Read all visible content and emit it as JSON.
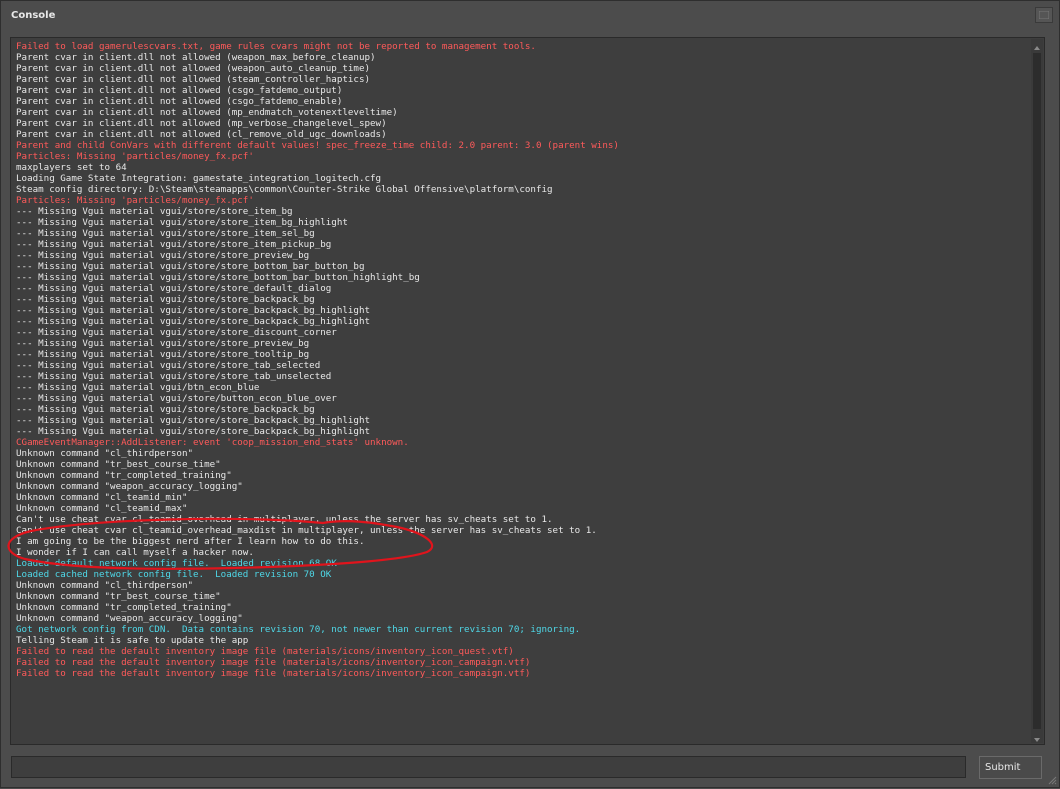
{
  "window": {
    "title": "Console"
  },
  "log": [
    {
      "text": "Failed to load gamerulescvars.txt, game rules cvars might not be reported to management tools.",
      "level": "error"
    },
    {
      "text": "Parent cvar in client.dll not allowed (weapon_max_before_cleanup)",
      "level": "normal"
    },
    {
      "text": "Parent cvar in client.dll not allowed (weapon_auto_cleanup_time)",
      "level": "normal"
    },
    {
      "text": "Parent cvar in client.dll not allowed (steam_controller_haptics)",
      "level": "normal"
    },
    {
      "text": "Parent cvar in client.dll not allowed (csgo_fatdemo_output)",
      "level": "normal"
    },
    {
      "text": "Parent cvar in client.dll not allowed (csgo_fatdemo_enable)",
      "level": "normal"
    },
    {
      "text": "Parent cvar in client.dll not allowed (mp_endmatch_votenextleveltime)",
      "level": "normal"
    },
    {
      "text": "Parent cvar in client.dll not allowed (mp_verbose_changelevel_spew)",
      "level": "normal"
    },
    {
      "text": "Parent cvar in client.dll not allowed (cl_remove_old_ugc_downloads)",
      "level": "normal"
    },
    {
      "text": "Parent and child ConVars with different default values! spec_freeze_time child: 2.0 parent: 3.0 (parent wins)",
      "level": "error"
    },
    {
      "text": "Particles: Missing 'particles/money_fx.pcf'",
      "level": "error"
    },
    {
      "text": "maxplayers set to 64",
      "level": "normal"
    },
    {
      "text": "Loading Game State Integration: gamestate_integration_logitech.cfg",
      "level": "normal"
    },
    {
      "text": "Steam config directory: D:\\Steam\\steamapps\\common\\Counter-Strike Global Offensive\\platform\\config",
      "level": "normal"
    },
    {
      "text": "Particles: Missing 'particles/money_fx.pcf'",
      "level": "error"
    },
    {
      "text": "--- Missing Vgui material vgui/store/store_item_bg",
      "level": "normal"
    },
    {
      "text": "--- Missing Vgui material vgui/store/store_item_bg_highlight",
      "level": "normal"
    },
    {
      "text": "--- Missing Vgui material vgui/store/store_item_sel_bg",
      "level": "normal"
    },
    {
      "text": "--- Missing Vgui material vgui/store/store_item_pickup_bg",
      "level": "normal"
    },
    {
      "text": "--- Missing Vgui material vgui/store/store_preview_bg",
      "level": "normal"
    },
    {
      "text": "--- Missing Vgui material vgui/store/store_bottom_bar_button_bg",
      "level": "normal"
    },
    {
      "text": "--- Missing Vgui material vgui/store/store_bottom_bar_button_highlight_bg",
      "level": "normal"
    },
    {
      "text": "--- Missing Vgui material vgui/store/store_default_dialog",
      "level": "normal"
    },
    {
      "text": "--- Missing Vgui material vgui/store/store_backpack_bg",
      "level": "normal"
    },
    {
      "text": "--- Missing Vgui material vgui/store/store_backpack_bg_highlight",
      "level": "normal"
    },
    {
      "text": "--- Missing Vgui material vgui/store/store_backpack_bg_highlight",
      "level": "normal"
    },
    {
      "text": "--- Missing Vgui material vgui/store/store_discount_corner",
      "level": "normal"
    },
    {
      "text": "--- Missing Vgui material vgui/store/store_preview_bg",
      "level": "normal"
    },
    {
      "text": "--- Missing Vgui material vgui/store/store_tooltip_bg",
      "level": "normal"
    },
    {
      "text": "--- Missing Vgui material vgui/store/store_tab_selected",
      "level": "normal"
    },
    {
      "text": "--- Missing Vgui material vgui/store/store_tab_unselected",
      "level": "normal"
    },
    {
      "text": "--- Missing Vgui material vgui/btn_econ_blue",
      "level": "normal"
    },
    {
      "text": "--- Missing Vgui material vgui/store/button_econ_blue_over",
      "level": "normal"
    },
    {
      "text": "--- Missing Vgui material vgui/store/store_backpack_bg",
      "level": "normal"
    },
    {
      "text": "--- Missing Vgui material vgui/store/store_backpack_bg_highlight",
      "level": "normal"
    },
    {
      "text": "--- Missing Vgui material vgui/store/store_backpack_bg_highlight",
      "level": "normal"
    },
    {
      "text": "CGameEventManager::AddListener: event 'coop_mission_end_stats' unknown.",
      "level": "error"
    },
    {
      "text": "Unknown command \"cl_thirdperson\"",
      "level": "normal"
    },
    {
      "text": "Unknown command \"tr_best_course_time\"",
      "level": "normal"
    },
    {
      "text": "Unknown command \"tr_completed_training\"",
      "level": "normal"
    },
    {
      "text": "Unknown command \"weapon_accuracy_logging\"",
      "level": "normal"
    },
    {
      "text": "Unknown command \"cl_teamid_min\"",
      "level": "normal"
    },
    {
      "text": "Unknown command \"cl_teamid_max\"",
      "level": "normal"
    },
    {
      "text": "Can't use cheat cvar cl_teamid_overhead in multiplayer, unless the server has sv_cheats set to 1.",
      "level": "normal"
    },
    {
      "text": "Can't use cheat cvar cl_teamid_overhead_maxdist in multiplayer, unless the server has sv_cheats set to 1.",
      "level": "normal"
    },
    {
      "text": "I am going to be the biggest nerd after I learn how to do this.",
      "level": "normal"
    },
    {
      "text": "I wonder if I can call myself a hacker now.",
      "level": "normal"
    },
    {
      "text": "Loaded default network config file.  Loaded revision 68 OK",
      "level": "info"
    },
    {
      "text": "Loaded cached network config file.  Loaded revision 70 OK",
      "level": "info"
    },
    {
      "text": "Unknown command \"cl_thirdperson\"",
      "level": "normal"
    },
    {
      "text": "Unknown command \"tr_best_course_time\"",
      "level": "normal"
    },
    {
      "text": "Unknown command \"tr_completed_training\"",
      "level": "normal"
    },
    {
      "text": "Unknown command \"weapon_accuracy_logging\"",
      "level": "normal"
    },
    {
      "text": "Got network config from CDN.  Data contains revision 70, not newer than current revision 70; ignoring.",
      "level": "info"
    },
    {
      "text": "Telling Steam it is safe to update the app",
      "level": "normal"
    },
    {
      "text": "Failed to read the default inventory image file (materials/icons/inventory_icon_quest.vtf)",
      "level": "error"
    },
    {
      "text": "Failed to read the default inventory image file (materials/icons/inventory_icon_campaign.vtf)",
      "level": "error"
    },
    {
      "text": "Failed to read the default inventory image file (materials/icons/inventory_icon_campaign.vtf)",
      "level": "error"
    }
  ],
  "input": {
    "value": "",
    "placeholder": ""
  },
  "submit": {
    "label": "Submit"
  },
  "colors": {
    "normal": "#e8e8e8",
    "error": "#ff5a5a",
    "info": "#4fd8e8",
    "annotation": "#e0141c"
  },
  "icons": {
    "close": "close-icon",
    "scroll_up": "scroll-up-arrow-icon",
    "scroll_down": "scroll-down-arrow-icon",
    "resize": "resize-grip-icon"
  }
}
